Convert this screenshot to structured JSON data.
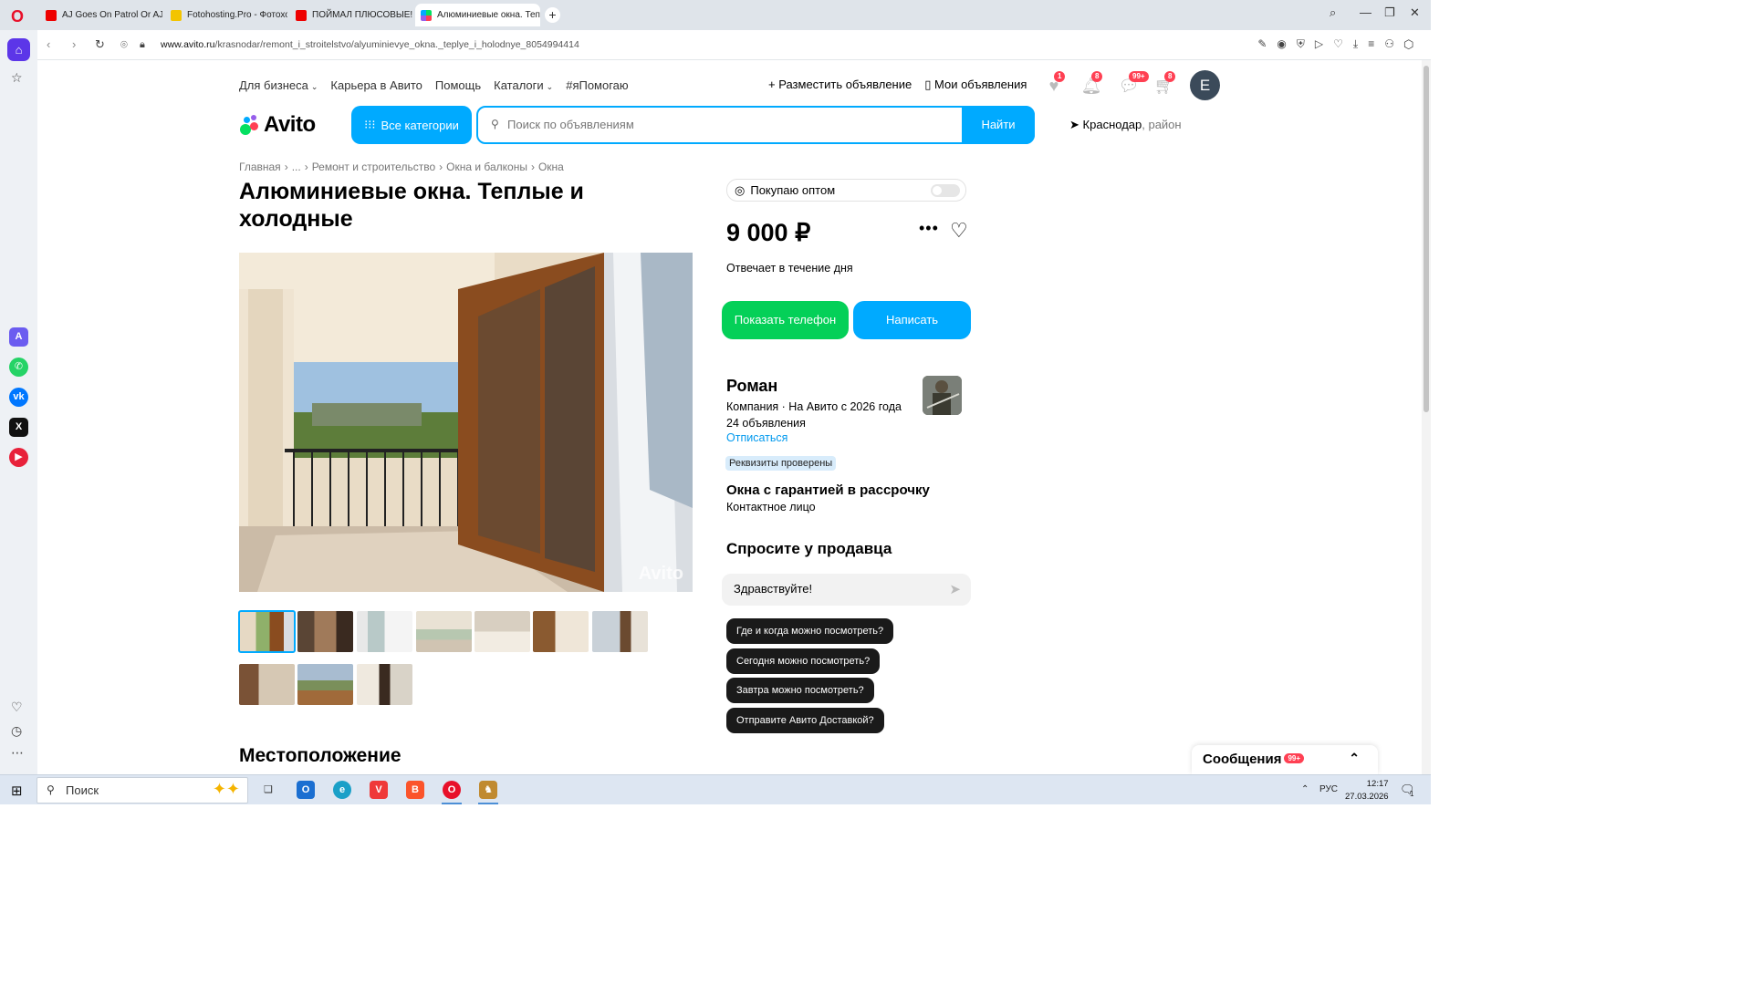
{
  "browser": {
    "tabs": [
      {
        "title": "AJ Goes On Patrol Or AJ S",
        "icon": "youtube-icon"
      },
      {
        "title": "Fotohosting.Pro - Фотохо",
        "icon": "fotohosting-icon"
      },
      {
        "title": "ПОЙМАЛ ПЛЮСОВЫЕ! Т",
        "icon": "youtube-icon"
      },
      {
        "title": "Алюминиевые окна. Теп",
        "icon": "avito-icon"
      }
    ],
    "url_host": "www.avito.ru",
    "url_path": "/krasnodar/remont_i_stroitelstvo/alyuminievye_okna._teplye_i_holodnye_8054994414"
  },
  "header": {
    "nav": [
      "Для бизнеса",
      "Карьера в Авито",
      "Помощь",
      "Каталоги",
      "#яПомогаю"
    ],
    "post_ad": "Разместить объявление",
    "my_ads": "Мои объявления",
    "badges": {
      "favorites": "1",
      "notifications": "8",
      "messages": "99+",
      "cart": "8"
    },
    "user_initial": "E",
    "logo_text": "Avito",
    "all_categories": "Все категории",
    "search_placeholder": "Поиск по объявлениям",
    "search_button": "Найти",
    "city": "Краснодар",
    "region": ", район"
  },
  "breadcrumb": [
    "Главная",
    "...",
    "Ремонт и строительство",
    "Окна и балконы",
    "Окна"
  ],
  "listing": {
    "title": "Алюминиевые окна. Теплые и холодные",
    "watermark": "Avito",
    "section_location": "Местоположение"
  },
  "sidebar_card": {
    "wholesale_label": "Покупаю оптом",
    "price": "9 000 ₽",
    "responds": "Отвечает в течение дня",
    "show_phone": "Показать телефон",
    "write": "Написать",
    "seller_name": "Роман",
    "seller_meta": "Компания · На Авито с 2026 года",
    "seller_ads": "24 объявления",
    "unsubscribe": "Отписаться",
    "verified": "Реквизиты проверены",
    "shop_name": "Окна с гарантией в рассрочку",
    "contact_person": "Контактное лицо",
    "ask_heading": "Спросите у продавца",
    "message_value": "Здравствуйте!",
    "quick_questions": [
      "Где и когда можно посмотреть?",
      "Сегодня можно посмотреть?",
      "Завтра можно посмотреть?",
      "Отправите Авито Доставкой?"
    ]
  },
  "messages_panel": {
    "label": "Сообщения",
    "badge": "99+"
  },
  "taskbar": {
    "search_label": "Поиск",
    "lang": "РУС",
    "time": "12:17",
    "date": "27.03.2026",
    "notif_count": "1"
  },
  "colors": {
    "accent": "#00aaff",
    "green": "#04d058",
    "badge": "#ff4053",
    "opera": "#e8102a"
  }
}
